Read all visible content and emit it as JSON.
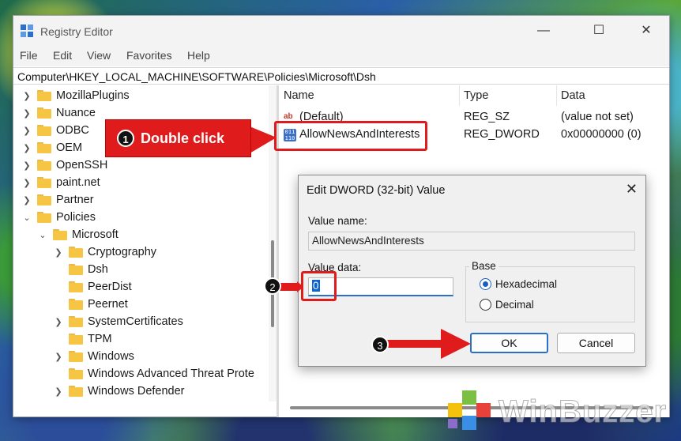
{
  "window": {
    "title": "Registry Editor",
    "controls": {
      "minimize": "—",
      "maximize": "☐",
      "close": "✕"
    }
  },
  "menu": [
    "File",
    "Edit",
    "View",
    "Favorites",
    "Help"
  ],
  "address": "Computer\\HKEY_LOCAL_MACHINE\\SOFTWARE\\Policies\\Microsoft\\Dsh",
  "tree": [
    {
      "label": "MozillaPlugins",
      "level": 1,
      "expander": ">"
    },
    {
      "label": "Nuance",
      "level": 1,
      "expander": ">"
    },
    {
      "label": "ODBC",
      "level": 1,
      "expander": ">"
    },
    {
      "label": "OEM",
      "level": 1,
      "expander": ">"
    },
    {
      "label": "OpenSSH",
      "level": 1,
      "expander": ">"
    },
    {
      "label": "paint.net",
      "level": 1,
      "expander": ">"
    },
    {
      "label": "Partner",
      "level": 1,
      "expander": ">"
    },
    {
      "label": "Policies",
      "level": 1,
      "expander": "v"
    },
    {
      "label": "Microsoft",
      "level": 2,
      "expander": "v"
    },
    {
      "label": "Cryptography",
      "level": 3,
      "expander": ">"
    },
    {
      "label": "Dsh",
      "level": 3,
      "expander": "",
      "selected": true
    },
    {
      "label": "PeerDist",
      "level": 3,
      "expander": ""
    },
    {
      "label": "Peernet",
      "level": 3,
      "expander": ""
    },
    {
      "label": "SystemCertificates",
      "level": 3,
      "expander": ">"
    },
    {
      "label": "TPM",
      "level": 3,
      "expander": ""
    },
    {
      "label": "Windows",
      "level": 3,
      "expander": ">"
    },
    {
      "label": "Windows Advanced Threat Prote",
      "level": 3,
      "expander": ""
    },
    {
      "label": "Windows Defender",
      "level": 3,
      "expander": ">"
    }
  ],
  "list": {
    "headers": {
      "name": "Name",
      "type": "Type",
      "data": "Data"
    },
    "rows": [
      {
        "name": "(Default)",
        "type": "REG_SZ",
        "data": "(value not set)",
        "icon": "ab"
      },
      {
        "name": "AllowNewsAndInterests",
        "type": "REG_DWORD",
        "data": "0x00000000 (0)",
        "icon": "dword"
      }
    ],
    "default_icon_text": "ab",
    "dword_icon_text": "011\n110"
  },
  "dialog": {
    "title": "Edit DWORD (32-bit) Value",
    "value_name_label": "Value name:",
    "value_name": "AllowNewsAndInterests",
    "value_data_label": "Value data:",
    "value_data": "0",
    "base_label": "Base",
    "hex_label": "Hexadecimal",
    "dec_label": "Decimal",
    "base_selected": "hexadecimal",
    "ok": "OK",
    "cancel": "Cancel",
    "close": "✕"
  },
  "annotations": {
    "step1_number": "1",
    "step1_text": "Double click",
    "step2_number": "2",
    "step3_number": "3",
    "accent": "#e01b1b"
  },
  "watermark": "WinBuzzer"
}
